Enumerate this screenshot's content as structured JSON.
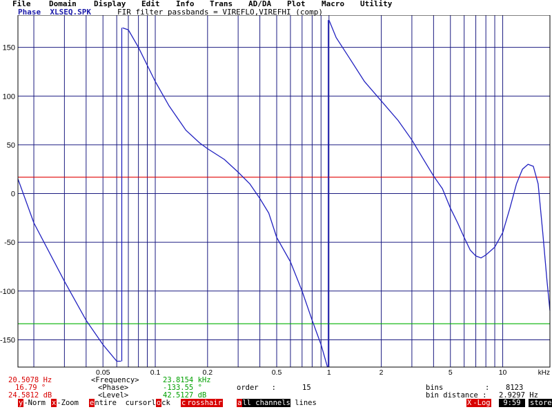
{
  "menu": [
    "File",
    "Domain",
    "Display",
    "Edit",
    "Info",
    "Trans",
    "AD/DA",
    "Plot",
    "Macro",
    "Utility"
  ],
  "title": {
    "prefix": "Phase  XLSEQ.SPK",
    "description": "FIR filter passbands = VIREFLO,VIREFHI (comp)"
  },
  "chart_data": {
    "type": "line",
    "x_scale": "log",
    "xlim": [
      0.0162,
      18.7
    ],
    "ylim": [
      -178,
      183
    ],
    "x_unit": "kHz",
    "x_ticks": [
      "0.05",
      "0.1",
      "0.2",
      "0.5",
      "1",
      "2",
      "5",
      "10"
    ],
    "y_ticks": [
      "150",
      "100",
      "50",
      "0",
      "-50",
      "-100",
      "-150"
    ],
    "grid": true,
    "x_grid_lines": [
      0.02,
      0.03,
      0.04,
      0.05,
      0.06,
      0.07,
      0.08,
      0.09,
      0.1,
      0.2,
      0.3,
      0.4,
      0.5,
      0.6,
      0.7,
      0.8,
      0.9,
      1,
      2,
      3,
      4,
      5,
      6,
      7,
      8,
      9,
      10
    ],
    "y_grid_lines": [
      150,
      100,
      50,
      0,
      -50,
      -100,
      -150
    ],
    "cursor_lines": [
      {
        "axis": "y",
        "value": 16.79,
        "color": "#e00000"
      },
      {
        "axis": "y",
        "value": -133.55,
        "color": "#00b000"
      }
    ],
    "series": [
      {
        "color": "#2020c0",
        "points": [
          [
            0.0162,
            15
          ],
          [
            0.02,
            -30
          ],
          [
            0.03,
            -90
          ],
          [
            0.04,
            -130
          ],
          [
            0.05,
            -155
          ],
          [
            0.06,
            -172
          ],
          [
            0.0635,
            -172
          ],
          [
            0.0648,
            170
          ],
          [
            0.07,
            168
          ],
          [
            0.08,
            150
          ],
          [
            0.1,
            115
          ],
          [
            0.12,
            90
          ],
          [
            0.15,
            65
          ],
          [
            0.18,
            52
          ],
          [
            0.2,
            46
          ],
          [
            0.25,
            35
          ],
          [
            0.3,
            22
          ],
          [
            0.35,
            10
          ],
          [
            0.4,
            -5
          ],
          [
            0.45,
            -20
          ],
          [
            0.5,
            -45
          ],
          [
            0.6,
            -70
          ],
          [
            0.7,
            -100
          ],
          [
            0.8,
            -130
          ],
          [
            0.9,
            -155
          ],
          [
            0.98,
            -178
          ],
          [
            1.0,
            178
          ],
          [
            1.1,
            160
          ],
          [
            1.3,
            140
          ],
          [
            1.6,
            115
          ],
          [
            2.0,
            95
          ],
          [
            2.5,
            75
          ],
          [
            3.0,
            55
          ],
          [
            3.5,
            35
          ],
          [
            4.0,
            18
          ],
          [
            4.5,
            5
          ],
          [
            5.0,
            -15
          ],
          [
            5.5,
            -30
          ],
          [
            6.0,
            -45
          ],
          [
            6.5,
            -58
          ],
          [
            7.0,
            -64
          ],
          [
            7.5,
            -66
          ],
          [
            8.0,
            -63
          ],
          [
            9.0,
            -55
          ],
          [
            10.0,
            -40
          ],
          [
            11.0,
            -15
          ],
          [
            12.0,
            10
          ],
          [
            13.0,
            25
          ],
          [
            14.0,
            30
          ],
          [
            15.0,
            28
          ],
          [
            16.0,
            10
          ],
          [
            17.0,
            -40
          ],
          [
            18.0,
            -90
          ],
          [
            18.7,
            -120
          ]
        ]
      }
    ]
  },
  "readout": {
    "cursor1_freq": "20.5078 Hz",
    "cursor1_phase": "16.79 °",
    "cursor1_level": "24.5812 dB",
    "freq_label": "<Frequency>",
    "phase_label": "<Phase>",
    "level_label": "<Level>",
    "cursor2_freq": "23.8154 kHz",
    "cursor2_phase": "-133.55 °",
    "cursor2_level": "42.5127 dB",
    "order_label": "order   :",
    "order_value": "15",
    "bins_label": "bins",
    "bins_sep": ":",
    "bins_value": "8123",
    "bin_distance_label": "bin distance :",
    "bin_distance_value": "2.9297 Hz"
  },
  "function_keys": [
    {
      "hot": "y",
      "rest": "-Norm",
      "style": "normal"
    },
    {
      "hot": "x",
      "rest": "-Zoom",
      "style": "normal"
    },
    {
      "hot": "e",
      "rest": "ntire  cursorl",
      "hot2": "o",
      "rest2": "ck",
      "style": "normal"
    },
    {
      "hot": "c",
      "rest": "rosshair",
      "style": "normal"
    },
    {
      "hot": "a",
      "rest": "ll channels",
      "suffix": " lines",
      "style": "normal"
    },
    {
      "hot": "X",
      "rest": "-Log",
      "style": "normal"
    },
    {
      "text": " 9:59 ",
      "style": "inverse"
    },
    {
      "text": "store",
      "style": "inverse"
    }
  ],
  "colors": {
    "trace": "#2020c0",
    "grid": "#1a1a80",
    "cursor_red": "#e00000",
    "cursor_green": "#00b000"
  }
}
